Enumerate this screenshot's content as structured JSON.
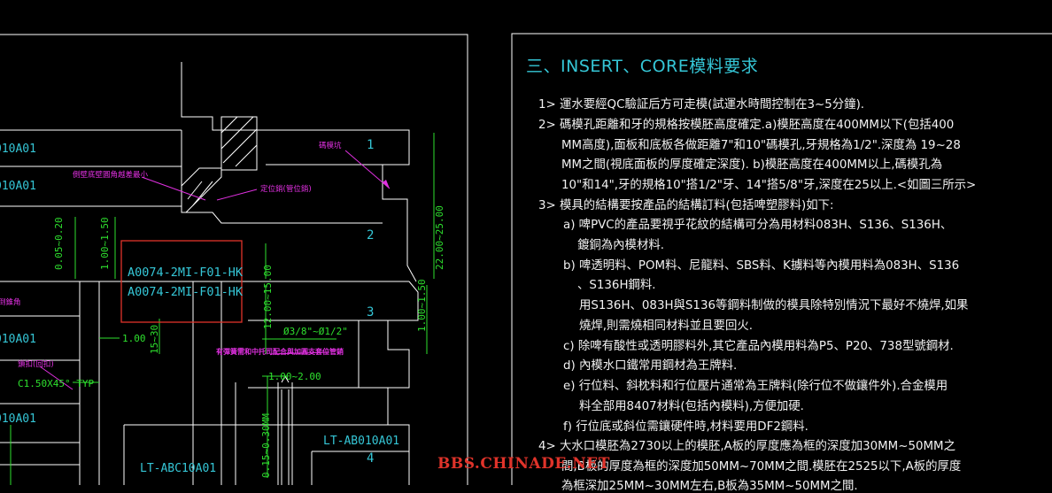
{
  "drawing": {
    "part_labels": {
      "a1": "A0074-2MI-F01-HK",
      "a2": "A0074-2MI-F01-HK",
      "lt1": "LT-AB010A01",
      "lt2": "LT-ABC10A01",
      "left1": "010A01",
      "left2": "010A01",
      "left3": "010A01",
      "left4": "010A01"
    },
    "numbers": {
      "n1": "1",
      "n2": "2",
      "n3": "3",
      "n4": "4"
    },
    "dims": {
      "d1": "0.05~0.20",
      "d2": "1.00~1.50",
      "d3": "22.00~25.00",
      "d4": "12.00~15.00",
      "d5": "15~30",
      "d6": "1.00",
      "d7": "1.00~1.50",
      "d8": "1.00~2.00",
      "d9": "0.15~0.30MM",
      "d10": "Ø3/8\"~Ø1/2\"",
      "d11": "C1.50X45° TYP"
    },
    "annotations": {
      "m1": "碼模坑",
      "m2": "側壁底壁圓角越差最小",
      "m3": "定位銷(管位銷)",
      "m4": "有彈簧需和中托司配合與加圓支套位管銷",
      "m5": "鎖扣(回扣)",
      "m6": "倒錐角"
    }
  },
  "notes": {
    "title": "三、INSERT、CORE模料要求",
    "lines": [
      "1>  運水要經QC驗証后方可走模(試運水時間控制在3~5分鐘).",
      "2>  碼模孔距離和牙的規格按模胚高度確定.a)模胚高度在400MM以下(包括400",
      "MM高度),面板和底板各做距離7\"和10\"碼模孔,牙規格為1/2\".深度為 19~28",
      "MM之間(視底面板的厚度確定深度).  b)模胚高度在400MM以上,碼模孔為",
      "10\"和14\",牙的規格10\"搭1/2\"牙、14\"搭5/8\"牙,深度在25以上.<如圖三所示>",
      "3>  模具的結構要按產品的結構訂料(包括啤塑膠料)如下:",
      "a) 啤PVC的產品要視乎花紋的結構可分為用材料083H、S136、S136H、",
      "鍍銅為內模材料.",
      "b) 啤透明料、POM料、尼龍料、SBS料、K擄料等內模用料為083H、S136",
      "、S136H鋼料.",
      "用S136H、083H與S136等鋼料制做的模具除特別情況下最好不燒焊,如果",
      "燒焊,則需燒相同材料並且要回火.",
      "c) 除啤有酸性或透明膠料外,其它產品內模用料為P5、P20、738型號鋼材.",
      "d) 內模水口鐵常用鋼材為王牌料.",
      "e) 行位料、斜枕料和行位壓片通常為王牌料(除行位不做鑲件外).合金模用",
      "料全部用8407材料(包括內模料),方便加硬.",
      "f) 行位底或斜位需鑲硬件時,材料要用DF2鋼料.",
      "4>  大水口模胚為2730以上的模胚,A板的厚度應為框的深度加30MM~50MM之",
      "間,B板的厚度為框的深度加50MM~70MM之間.模胚在2525以下,A板的厚度",
      "為框深加25MM~30MM左右,B板為35MM~50MM之間."
    ]
  },
  "watermark": "BBS.CHINADE.NET",
  "colors": {
    "background": "#000000",
    "line": "#ffffff",
    "cyan": "#35c6d6",
    "green": "#2ee02e",
    "magenta": "#e030e0",
    "red": "#e0332a"
  }
}
